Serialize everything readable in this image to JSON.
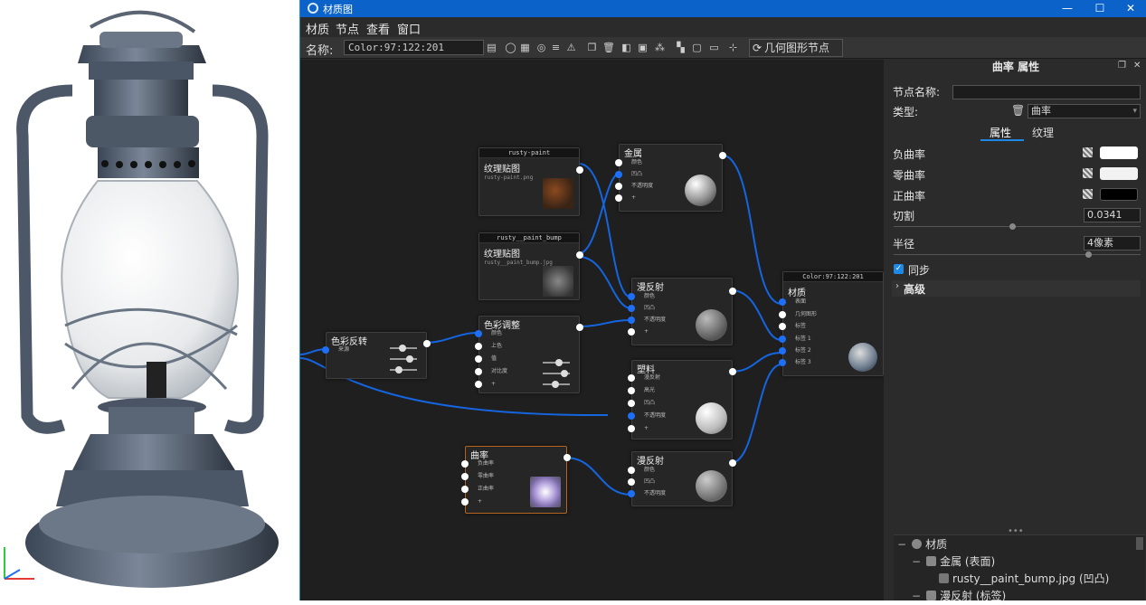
{
  "window": {
    "title": "材质图",
    "min": "—",
    "max": "☐",
    "close": "✕"
  },
  "menu": [
    "材质",
    "节点",
    "查看",
    "窗口"
  ],
  "toolbar": {
    "name_label": "名称:",
    "name_value": "Color:97:122:201",
    "geometry_button": "几何图形节点"
  },
  "nodes": {
    "rusty_paint": {
      "header": "rusty-paint",
      "title": "纹理贴图",
      "file": "rusty-paint.png"
    },
    "rusty_bump": {
      "header": "rusty__paint_bump",
      "title": "纹理贴图",
      "file": "rusty__paint_bump.jpg"
    },
    "metal": {
      "title": "金属",
      "ports": [
        "颜色",
        "凹凸",
        "不透明度",
        "+"
      ]
    },
    "diffuse1": {
      "title": "漫反射",
      "ports": [
        "颜色",
        "凹凸",
        "不透明度",
        "+"
      ]
    },
    "color_invert": {
      "title": "色彩反转",
      "ports": [
        "来源"
      ]
    },
    "color_adjust": {
      "title": "色彩调整",
      "ports": [
        "颜色",
        "上色",
        "值",
        "对比度",
        "+"
      ]
    },
    "plastic": {
      "title": "塑料",
      "ports": [
        "漫反射",
        "高光",
        "凹凸",
        "不透明度",
        "+"
      ]
    },
    "curvature": {
      "title": "曲率",
      "ports": [
        "负曲率",
        "零曲率",
        "正曲率",
        "+"
      ]
    },
    "diffuse2": {
      "title": "漫反射",
      "ports": [
        "颜色",
        "凹凸",
        "不透明度"
      ]
    },
    "material": {
      "header": "Color:97:122:201",
      "title": "材质",
      "ports": [
        "表面",
        "几何图形",
        "标签",
        "标签 1",
        "标签 2",
        "标签 3"
      ]
    }
  },
  "props": {
    "title": "曲率 属性",
    "node_name_label": "节点名称:",
    "node_name_value": "",
    "type_label": "类型:",
    "type_value": "曲率",
    "tab_props": "属性",
    "tab_texture": "纹理",
    "neg_curv": "负曲率",
    "zero_curv": "零曲率",
    "pos_curv": "正曲率",
    "cut_label": "切割",
    "cut_value": "0.0341",
    "radius_label": "半径",
    "radius_value": "4像素",
    "sync_label": "同步",
    "advanced_label": "高级",
    "colors": {
      "neg": "#ffffff",
      "zero": "#f2f2f2",
      "pos": "#000000"
    }
  },
  "tree": {
    "root": "材质",
    "child1": "金属 (表面)",
    "child1a": "rusty__paint_bump.jpg (凹凸)",
    "child2": "漫反射 (标签)"
  }
}
